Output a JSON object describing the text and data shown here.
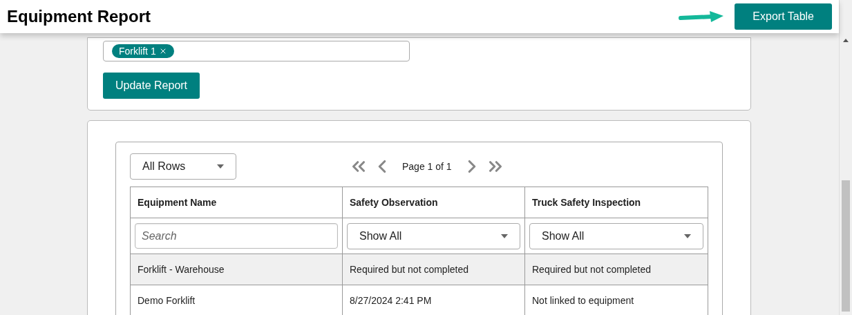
{
  "header": {
    "title": "Equipment Report",
    "export_button": "Export Table"
  },
  "filter": {
    "chips": [
      {
        "label": "Forklift 1"
      }
    ],
    "update_button": "Update Report"
  },
  "table_controls": {
    "rows_select": "All Rows",
    "page_label": "Page 1 of 1"
  },
  "table": {
    "columns": [
      {
        "label": "Equipment Name",
        "filter": {
          "kind": "search",
          "placeholder": "Search"
        }
      },
      {
        "label": "Safety Observation",
        "filter": {
          "kind": "select",
          "value": "Show All"
        }
      },
      {
        "label": "Truck Safety Inspection",
        "filter": {
          "kind": "select",
          "value": "Show All"
        }
      }
    ],
    "rows": [
      {
        "cells": [
          "Forklift - Warehouse",
          "Required but not completed",
          "Required but not completed"
        ],
        "selected": true
      },
      {
        "cells": [
          "Demo Forklift",
          "8/27/2024 2:41 PM",
          "Not linked to equipment"
        ],
        "selected": false
      }
    ]
  }
}
